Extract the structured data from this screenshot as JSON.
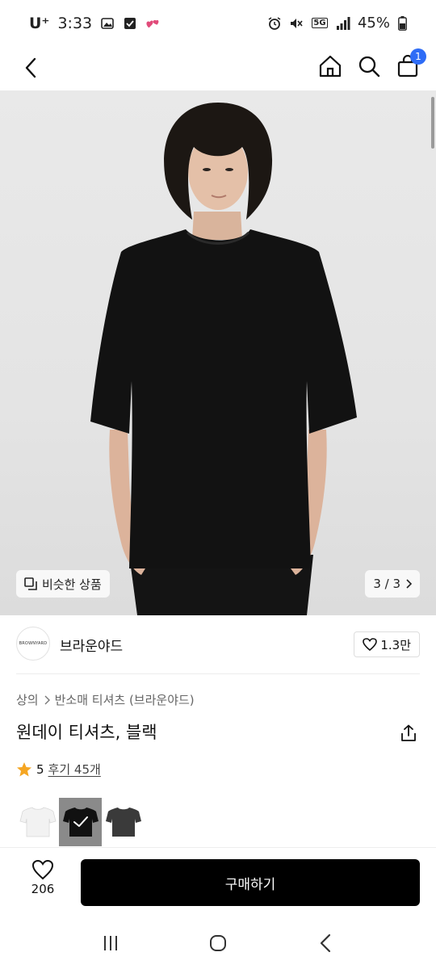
{
  "status_bar": {
    "carrier": "U⁺",
    "time": "3:33",
    "battery": "45%",
    "network": "5G"
  },
  "header": {
    "cart_count": "1"
  },
  "hero": {
    "similar_label": "비슷한 상품",
    "page_indicator": "3 / 3"
  },
  "brand": {
    "logo_text": "BROWNYARD",
    "name": "브라운야드",
    "like_count": "1.3만"
  },
  "breadcrumb": {
    "items": [
      "상의",
      "반소매 티셔츠 (브라운야드)"
    ]
  },
  "product": {
    "title": "원데이 티셔츠, 블랙",
    "rating": "5",
    "review_text": "후기 45개"
  },
  "colors": {
    "swatches": [
      {
        "name": "white",
        "color": "#f2f2f2",
        "selected": false
      },
      {
        "name": "black",
        "color": "#111111",
        "selected": true
      },
      {
        "name": "charcoal",
        "color": "#3a3a3a",
        "selected": false
      }
    ],
    "accent_blue": "#2e6cf6",
    "star_orange": "#f5a623"
  },
  "bottom": {
    "wish_count": "206",
    "buy_label": "구매하기"
  }
}
